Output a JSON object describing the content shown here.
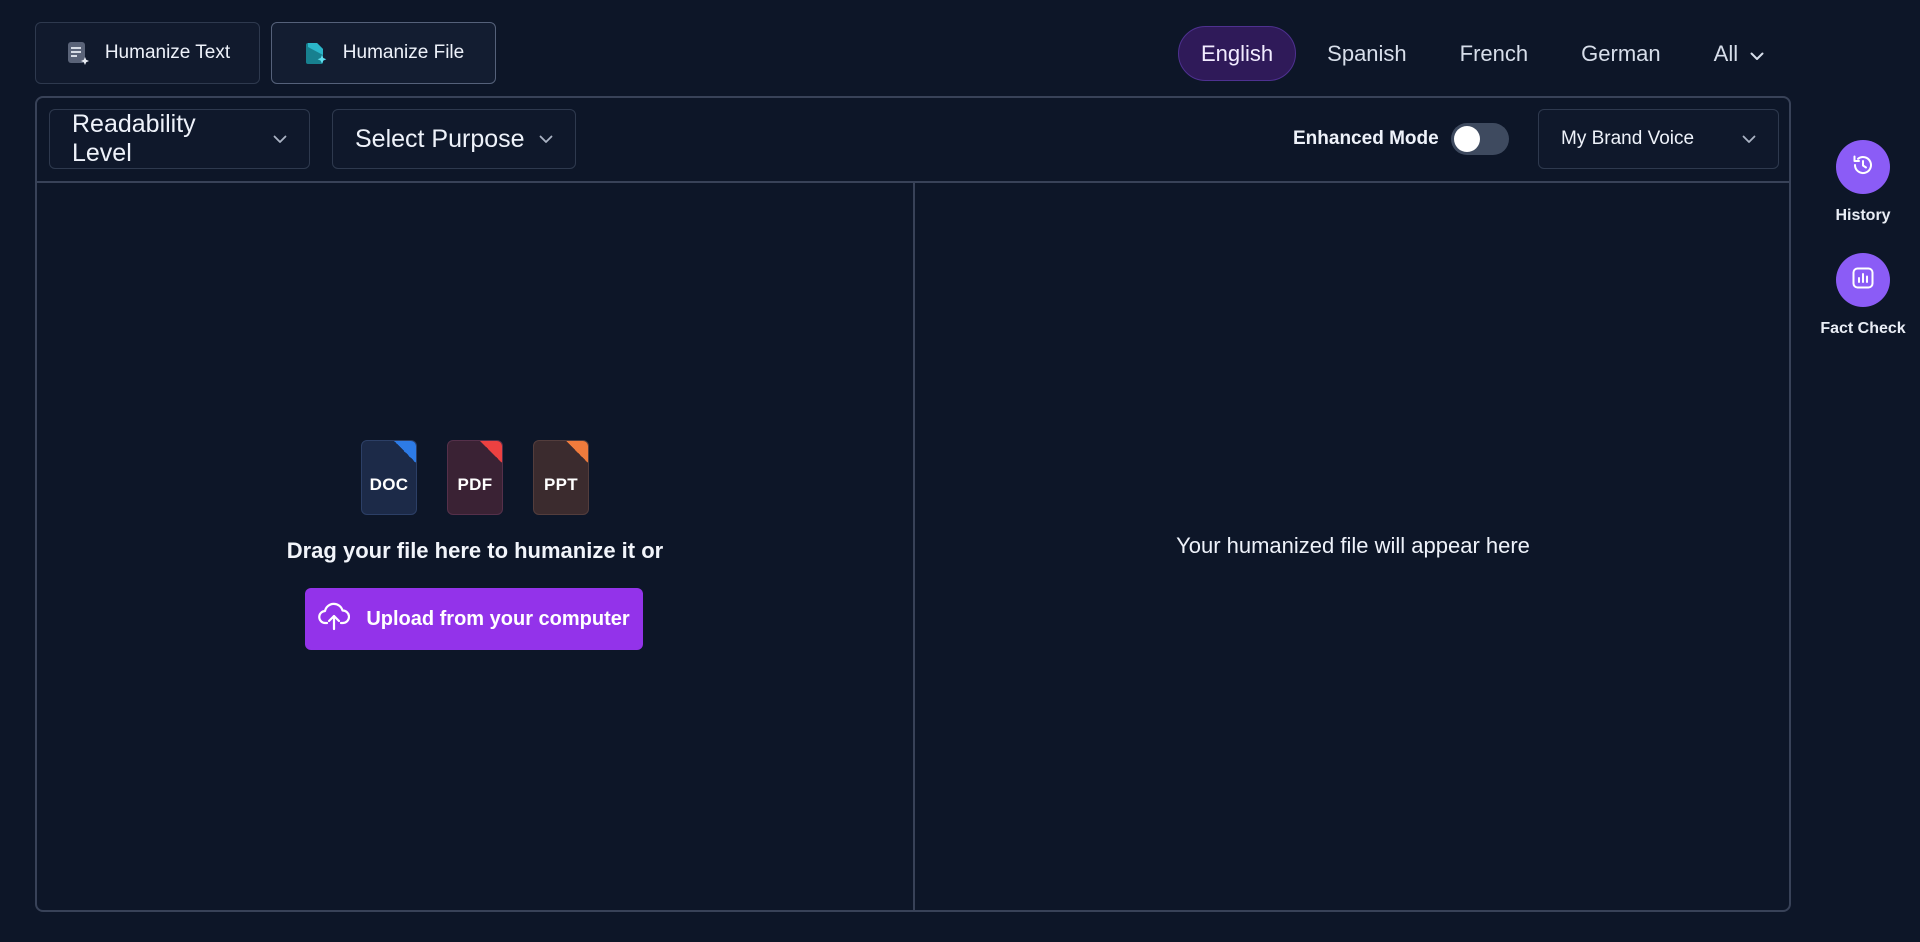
{
  "mode_tabs": [
    {
      "label": "Humanize Text",
      "icon": "document-lines-icon",
      "active": false
    },
    {
      "label": "Humanize File",
      "icon": "file-sparkle-icon",
      "active": true
    }
  ],
  "languages": {
    "items": [
      "English",
      "Spanish",
      "French",
      "German"
    ],
    "selected": "English",
    "all_label": "All"
  },
  "toolbar": {
    "readability_label": "Readability Level",
    "purpose_label": "Select Purpose",
    "enhanced_mode_label": "Enhanced Mode",
    "enhanced_mode_on": false,
    "brand_voice_label": "My Brand Voice"
  },
  "input_pane": {
    "file_types": [
      "DOC",
      "PDF",
      "PPT"
    ],
    "drag_text": "Drag your file here to humanize it or",
    "upload_label": "Upload from your computer"
  },
  "output_pane": {
    "placeholder": "Your humanized file will appear here"
  },
  "side_actions": [
    {
      "label": "History",
      "icon": "history-icon"
    },
    {
      "label": "Fact Check",
      "icon": "chart-icon"
    }
  ],
  "colors": {
    "background": "#0d1628",
    "accent": "#9333ea",
    "side_button": "#8b5cf6",
    "active_language_bg": "#2f1a59"
  }
}
